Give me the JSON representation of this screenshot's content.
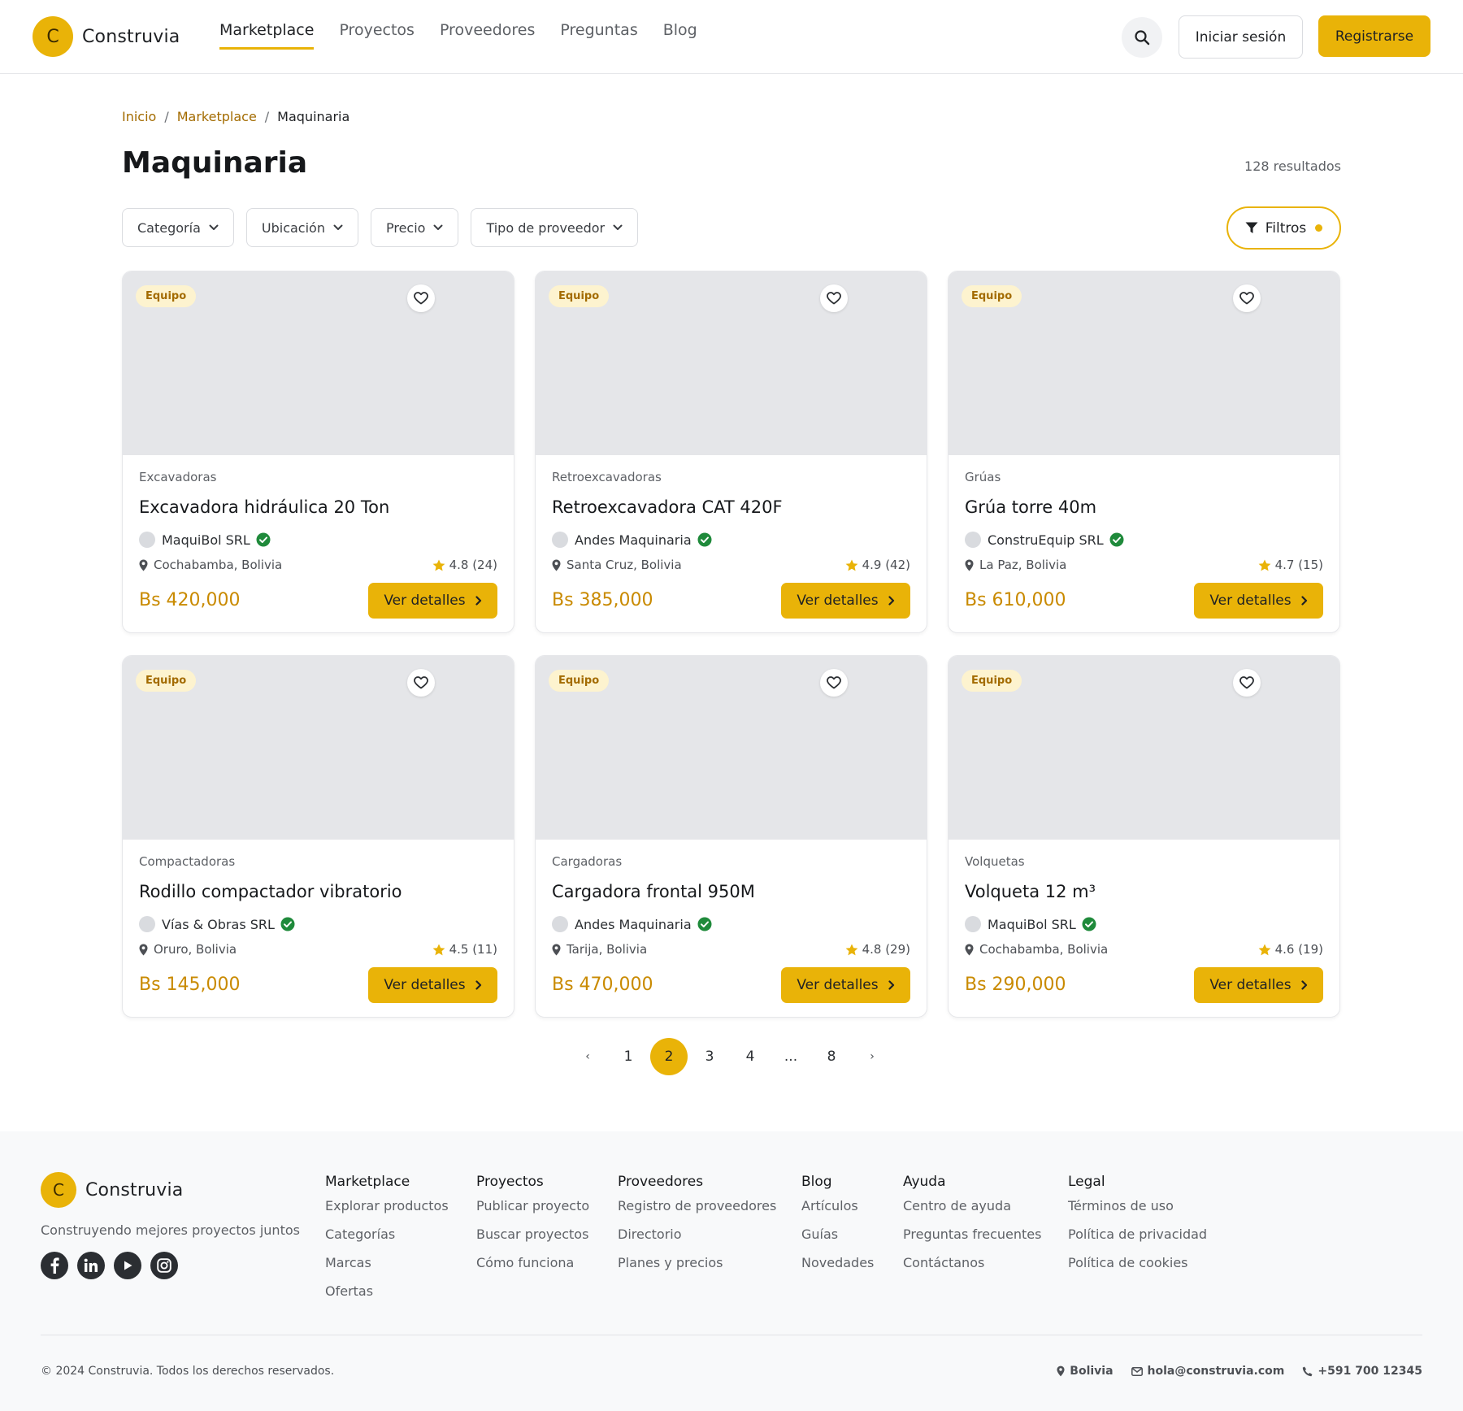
{
  "brand": {
    "logo_letter": "C",
    "name": "Construvia",
    "accent_color": "#e9b308",
    "price_color": "#c98a00"
  },
  "nav": {
    "items": [
      "Marketplace",
      "Proyectos",
      "Proveedores",
      "Preguntas",
      "Blog"
    ],
    "active": "Marketplace"
  },
  "header": {
    "search_icon": "search-icon",
    "login_label": "Iniciar sesión",
    "register_label": "Registrarse"
  },
  "breadcrumb": {
    "home": "Inicio",
    "section": "Marketplace",
    "current": "Maquinaria",
    "separator": "/"
  },
  "page": {
    "title": "Maquinaria",
    "results": "128 resultados"
  },
  "filters": {
    "items": [
      "Categoría",
      "Ubicación",
      "Precio",
      "Tipo de proveedor"
    ],
    "button_label": "Filtros"
  },
  "cards": [
    {
      "badge": "Equipo",
      "category": "Excavadoras",
      "title": "Excavadora hidráulica 20 Ton",
      "vendor": "MaquiBol SRL",
      "location": "Cochabamba, Bolivia",
      "rating": "4.8 (24)",
      "price": "Bs 420,000",
      "button": "Ver detalles"
    },
    {
      "badge": "Equipo",
      "category": "Retroexcavadoras",
      "title": "Retroexcavadora CAT 420F",
      "vendor": "Andes Maquinaria",
      "location": "Santa Cruz, Bolivia",
      "rating": "4.9 (42)",
      "price": "Bs 385,000",
      "button": "Ver detalles"
    },
    {
      "badge": "Equipo",
      "category": "Grúas",
      "title": "Grúa torre 40m",
      "vendor": "ConstruEquip SRL",
      "location": "La Paz, Bolivia",
      "rating": "4.7 (15)",
      "price": "Bs 610,000",
      "button": "Ver detalles"
    },
    {
      "badge": "Equipo",
      "category": "Compactadoras",
      "title": "Rodillo compactador vibratorio",
      "vendor": "Vías & Obras SRL",
      "location": "Oruro, Bolivia",
      "rating": "4.5 (11)",
      "price": "Bs 145,000",
      "button": "Ver detalles"
    },
    {
      "badge": "Equipo",
      "category": "Cargadoras",
      "title": "Cargadora frontal 950M",
      "vendor": "Andes Maquinaria",
      "location": "Tarija, Bolivia",
      "rating": "4.8 (29)",
      "price": "Bs 470,000",
      "button": "Ver detalles"
    },
    {
      "badge": "Equipo",
      "category": "Volquetas",
      "title": "Volqueta 12 m³",
      "vendor": "MaquiBol SRL",
      "location": "Cochabamba, Bolivia",
      "rating": "4.6 (19)",
      "price": "Bs 290,000",
      "button": "Ver detalles"
    }
  ],
  "pagination": {
    "prev": "‹",
    "pages": [
      "1",
      "2",
      "3",
      "4",
      "...",
      "8"
    ],
    "current": "2",
    "next": "›"
  },
  "footer": {
    "tagline": "Construyendo mejores proyectos juntos",
    "socials": [
      "facebook-icon",
      "linkedin-icon",
      "youtube-icon",
      "instagram-icon"
    ],
    "columns": [
      {
        "title": "Marketplace",
        "links": [
          "Explorar productos",
          "Categorías",
          "Marcas",
          "Ofertas"
        ]
      },
      {
        "title": "Proyectos",
        "links": [
          "Publicar proyecto",
          "Buscar proyectos",
          "Cómo funciona"
        ]
      },
      {
        "title": "Proveedores",
        "links": [
          "Registro de proveedores",
          "Directorio",
          "Planes y precios"
        ]
      },
      {
        "title": "Blog",
        "links": [
          "Artículos",
          "Guías",
          "Novedades"
        ]
      },
      {
        "title": "Ayuda",
        "links": [
          "Centro de ayuda",
          "Preguntas frecuentes",
          "Contáctanos"
        ]
      },
      {
        "title": "Legal",
        "links": [
          "Términos de uso",
          "Política de privacidad",
          "Política de cookies"
        ]
      }
    ],
    "copyright": "© 2024 Construvia. Todos los derechos reservados.",
    "country": "Bolivia",
    "email": "hola@construvia.com",
    "phone": "+591 700 12345"
  }
}
